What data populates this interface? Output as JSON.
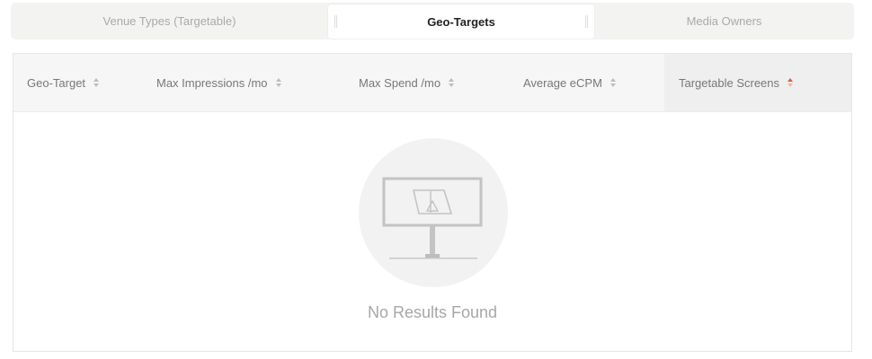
{
  "tabs": {
    "venue_types": "Venue Types (Targetable)",
    "geo_targets": "Geo-Targets",
    "media_owners": "Media Owners",
    "active": "Geo-Targets"
  },
  "table": {
    "columns": [
      {
        "label": "Geo-Target"
      },
      {
        "label": "Max Impressions /mo"
      },
      {
        "label": "Max Spend /mo"
      },
      {
        "label": "Average eCPM"
      },
      {
        "label": "Targetable Screens",
        "sorted": true
      }
    ],
    "rows": [],
    "empty_message": "No Results Found"
  },
  "icons": {
    "empty_state": "screen-icon",
    "sort": "sort-icon"
  },
  "colors": {
    "active_sort": "#e05a3a",
    "inactive_sort": "#bdbdbd"
  }
}
